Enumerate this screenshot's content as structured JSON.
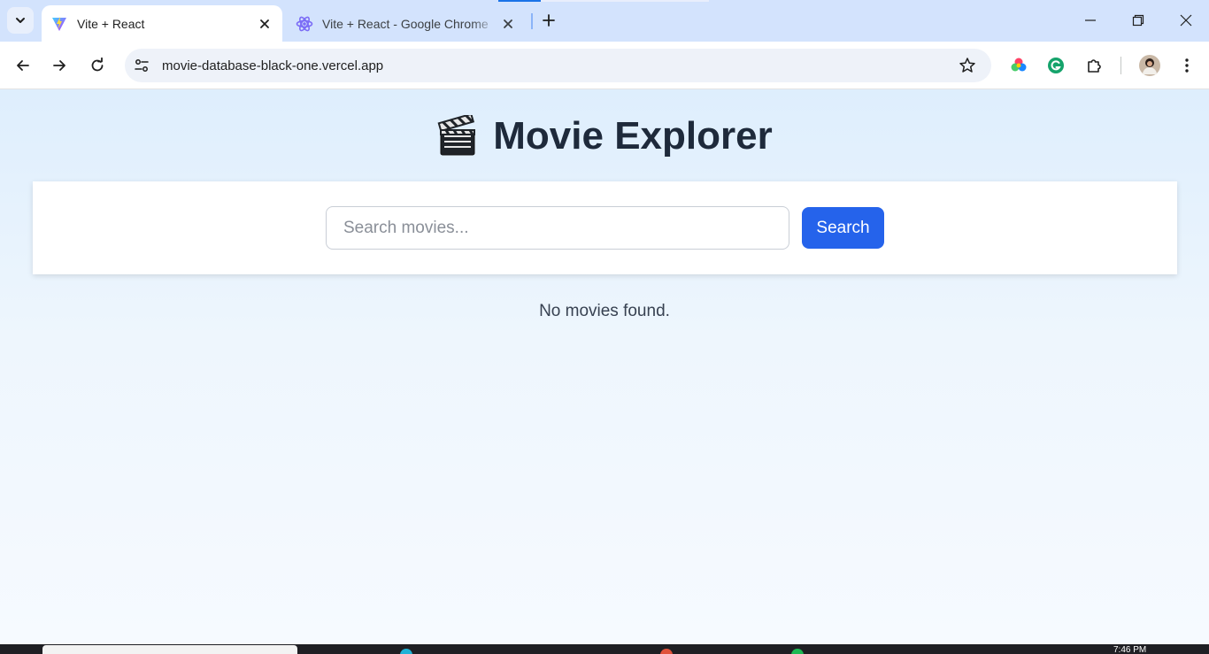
{
  "browser": {
    "tabs": [
      {
        "title": "Vite + React",
        "active": true,
        "favicon": "vite-icon"
      },
      {
        "title": "Vite + React - Google Chrome",
        "active": false,
        "favicon": "react-icon"
      }
    ],
    "address_bar": {
      "url": "movie-database-black-one.vercel.app"
    },
    "extensions": [
      "color-wheel-extension-icon",
      "grammarly-icon",
      "extensions-puzzle-icon"
    ],
    "colors": {
      "tabstrip": "#d3e3fd",
      "omnibox": "#eef2f9"
    }
  },
  "app": {
    "title": "Movie Explorer",
    "title_icon": "clapperboard-icon",
    "search": {
      "placeholder": "Search movies...",
      "value": "",
      "button_label": "Search"
    },
    "empty_message": "No movies found.",
    "colors": {
      "accent": "#2563eb",
      "title_text": "#1e2a3b"
    }
  },
  "taskbar": {
    "clock": "7:46 PM"
  }
}
